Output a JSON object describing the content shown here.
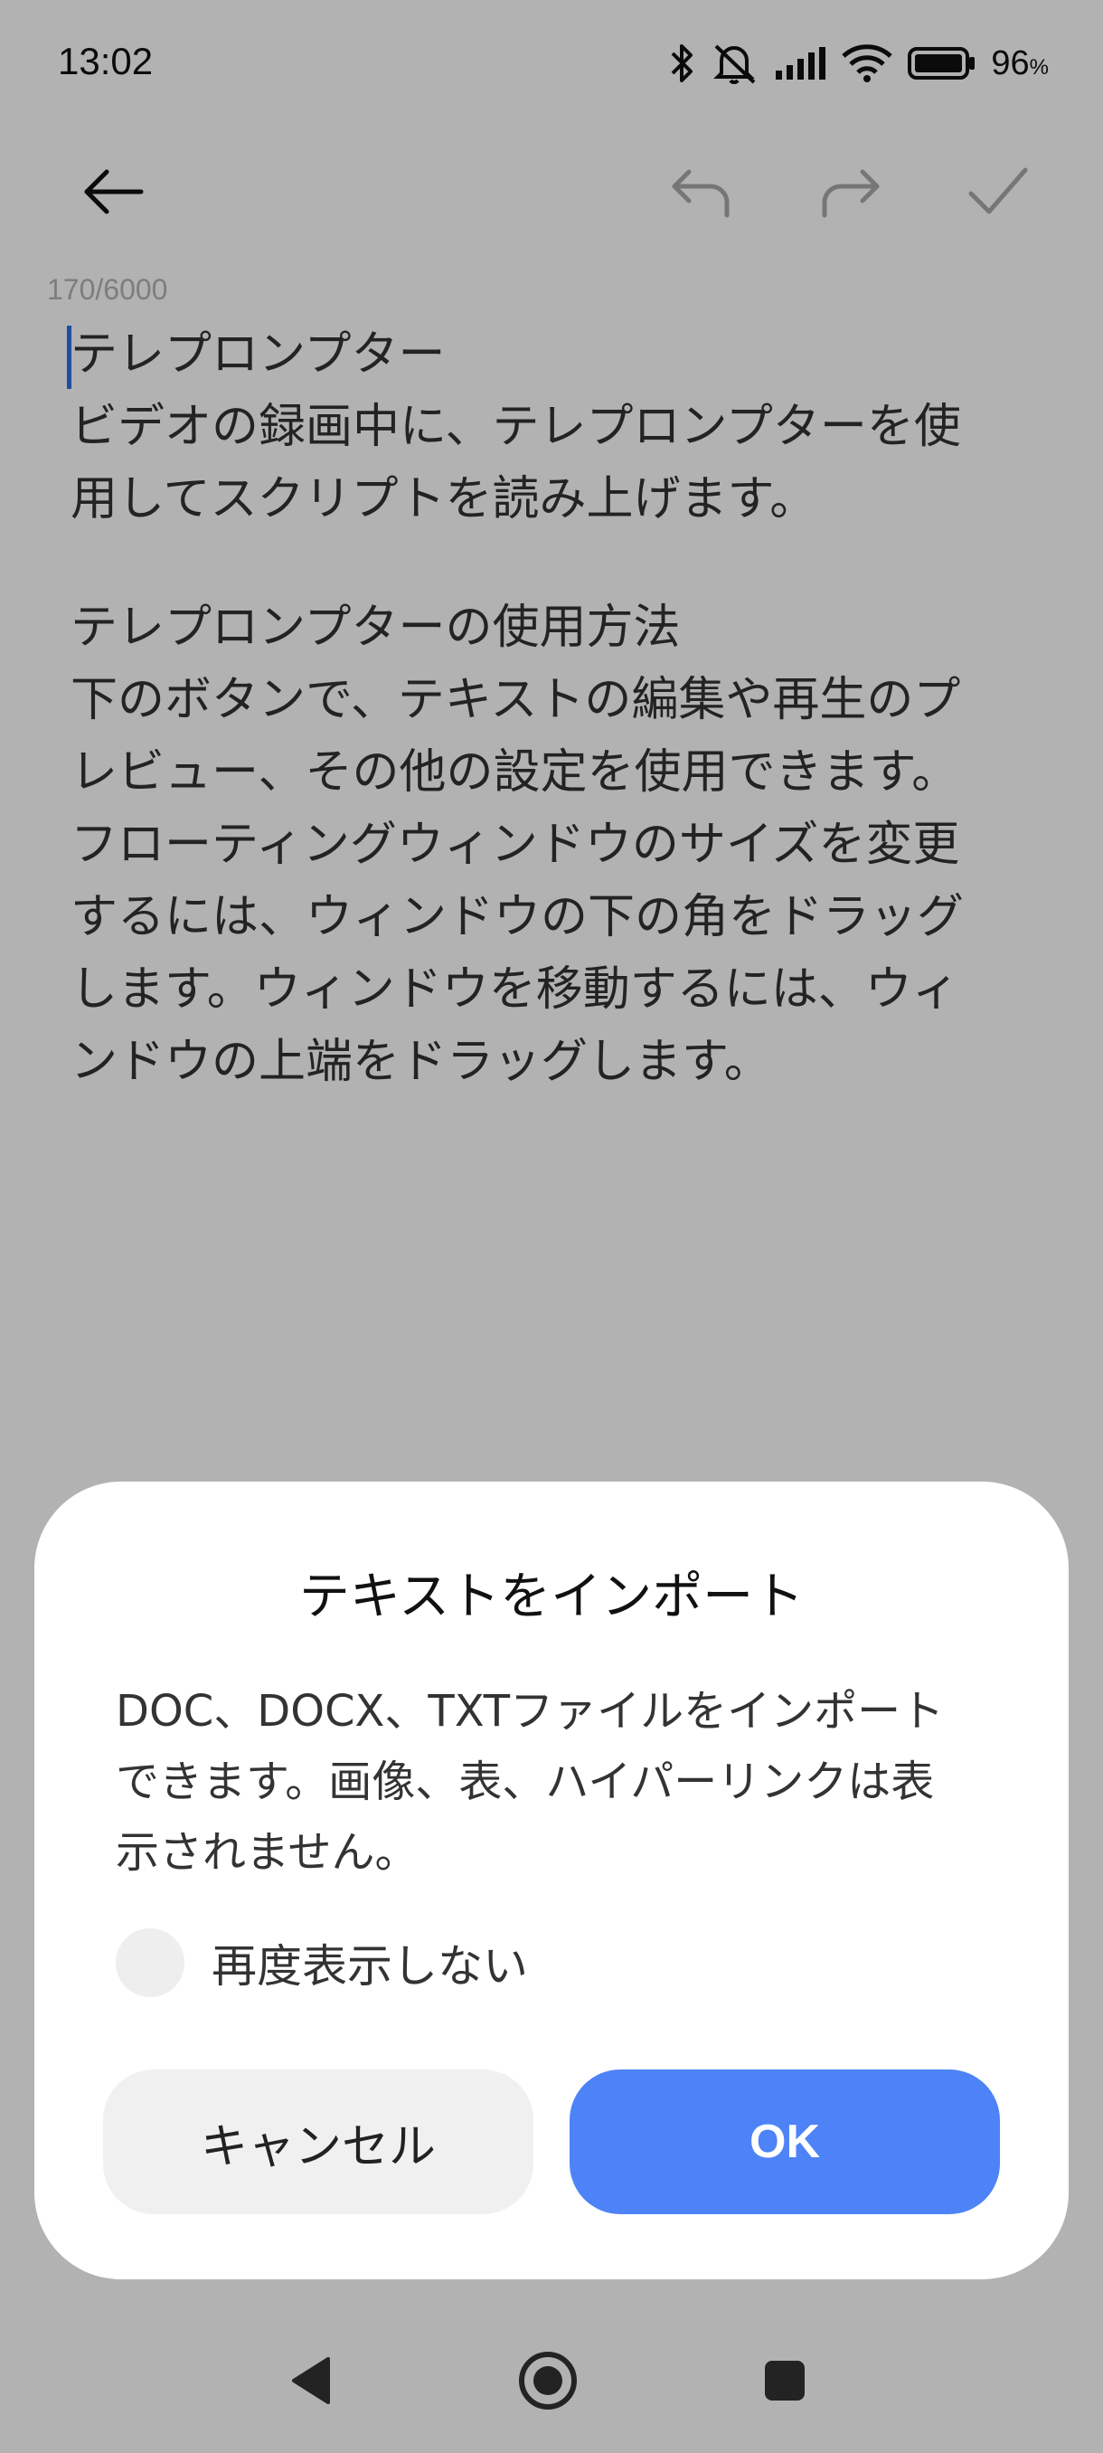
{
  "status_bar": {
    "time": "13:02",
    "battery_percent": "96",
    "battery_unit": "%",
    "icons": [
      "bluetooth-icon",
      "mute-icon",
      "signal-icon",
      "wifi-icon",
      "battery-icon"
    ]
  },
  "toolbar": {
    "icons": [
      "back-arrow-icon",
      "undo-icon",
      "redo-icon",
      "check-icon"
    ]
  },
  "editor": {
    "char_count": "170/6000",
    "paragraph1": [
      "テレプロンプター",
      "ビデオの録画中に、テレプロンプターを使",
      "用してスクリプトを読み上げます。"
    ],
    "paragraph2": [
      "テレプロンプターの使用方法",
      "下のボタンで、テキストの編集や再生のプ",
      "レビュー、その他の設定を使用できます。",
      "フローティングウィンドウのサイズを変更",
      "するには、ウィンドウの下の角をドラッグ",
      "します。ウィンドウを移動するには、ウィ",
      "ンドウの上端をドラッグします。"
    ]
  },
  "dialog": {
    "title": "テキストをインポート",
    "message_lines": [
      "DOC、DOCX、TXTファイルをインポート",
      "できます。画像、表、ハイパーリンクは表",
      "示されません。"
    ],
    "checkbox_label": "再度表示しない",
    "checkbox_checked": false,
    "cancel_label": "キャンセル",
    "ok_label": "OK"
  },
  "nav_bar": {
    "icons": [
      "back-triangle-icon",
      "home-circle-icon",
      "recents-square-icon"
    ]
  },
  "colors": {
    "accent": "#4d83f7",
    "caret": "#2f6fe4",
    "scrim": "rgba(0,0,0,0.30)"
  }
}
